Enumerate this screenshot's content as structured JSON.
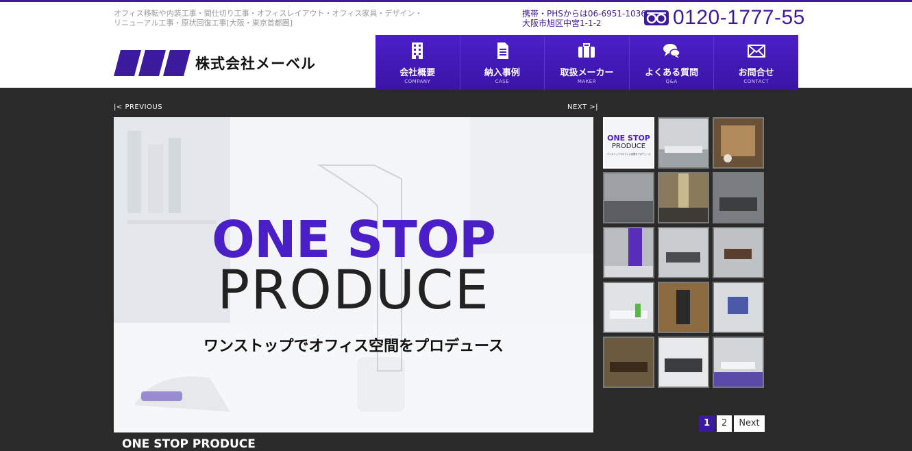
{
  "header": {
    "tagline_line1": "オフィス移転や内装工事・間仕切り工事・オフィスレイアウト・オフィス家具・デザイン・",
    "tagline_line2": "リニューアル工事・原状回復工事[大阪・東京首都圏]",
    "company_name": "株式会社メーベル",
    "mobile_phone": "携帯・PHSからは06-6951-1036",
    "address": "大阪市旭区中宮1-1-2",
    "freedial": "0120-1777-55"
  },
  "nav": [
    {
      "label": "会社概要",
      "sub": "COMPANY",
      "icon": "building-icon"
    },
    {
      "label": "納入事例",
      "sub": "CASE",
      "icon": "document-icon"
    },
    {
      "label": "取扱メーカー",
      "sub": "MAKER",
      "icon": "briefcase-icon"
    },
    {
      "label": "よくある質問",
      "sub": "Q&A",
      "icon": "chat-icon"
    },
    {
      "label": "お問合せ",
      "sub": "CONTACT",
      "icon": "mail-icon"
    }
  ],
  "slider": {
    "prev": "PREVIOUS",
    "next": "NEXT",
    "title_line1": "ONE STOP",
    "title_line2": "PRODUCE",
    "subtitle": "ワンストップでオフィス空間をプロデュース",
    "caption": "ONE STOP PRODUCE"
  },
  "thumbnails": [
    {
      "caption_title": "ONE STOP",
      "caption_title2": "PRODUCE",
      "caption_small": "ワンストップでオフィス空間をプロデュース"
    }
  ],
  "pagination": {
    "page1": "1",
    "page2": "2",
    "next": "Next"
  },
  "colors": {
    "brand": "#3c1a9e",
    "brand_light": "#4b1fc8",
    "background": "#2a2a2a"
  }
}
